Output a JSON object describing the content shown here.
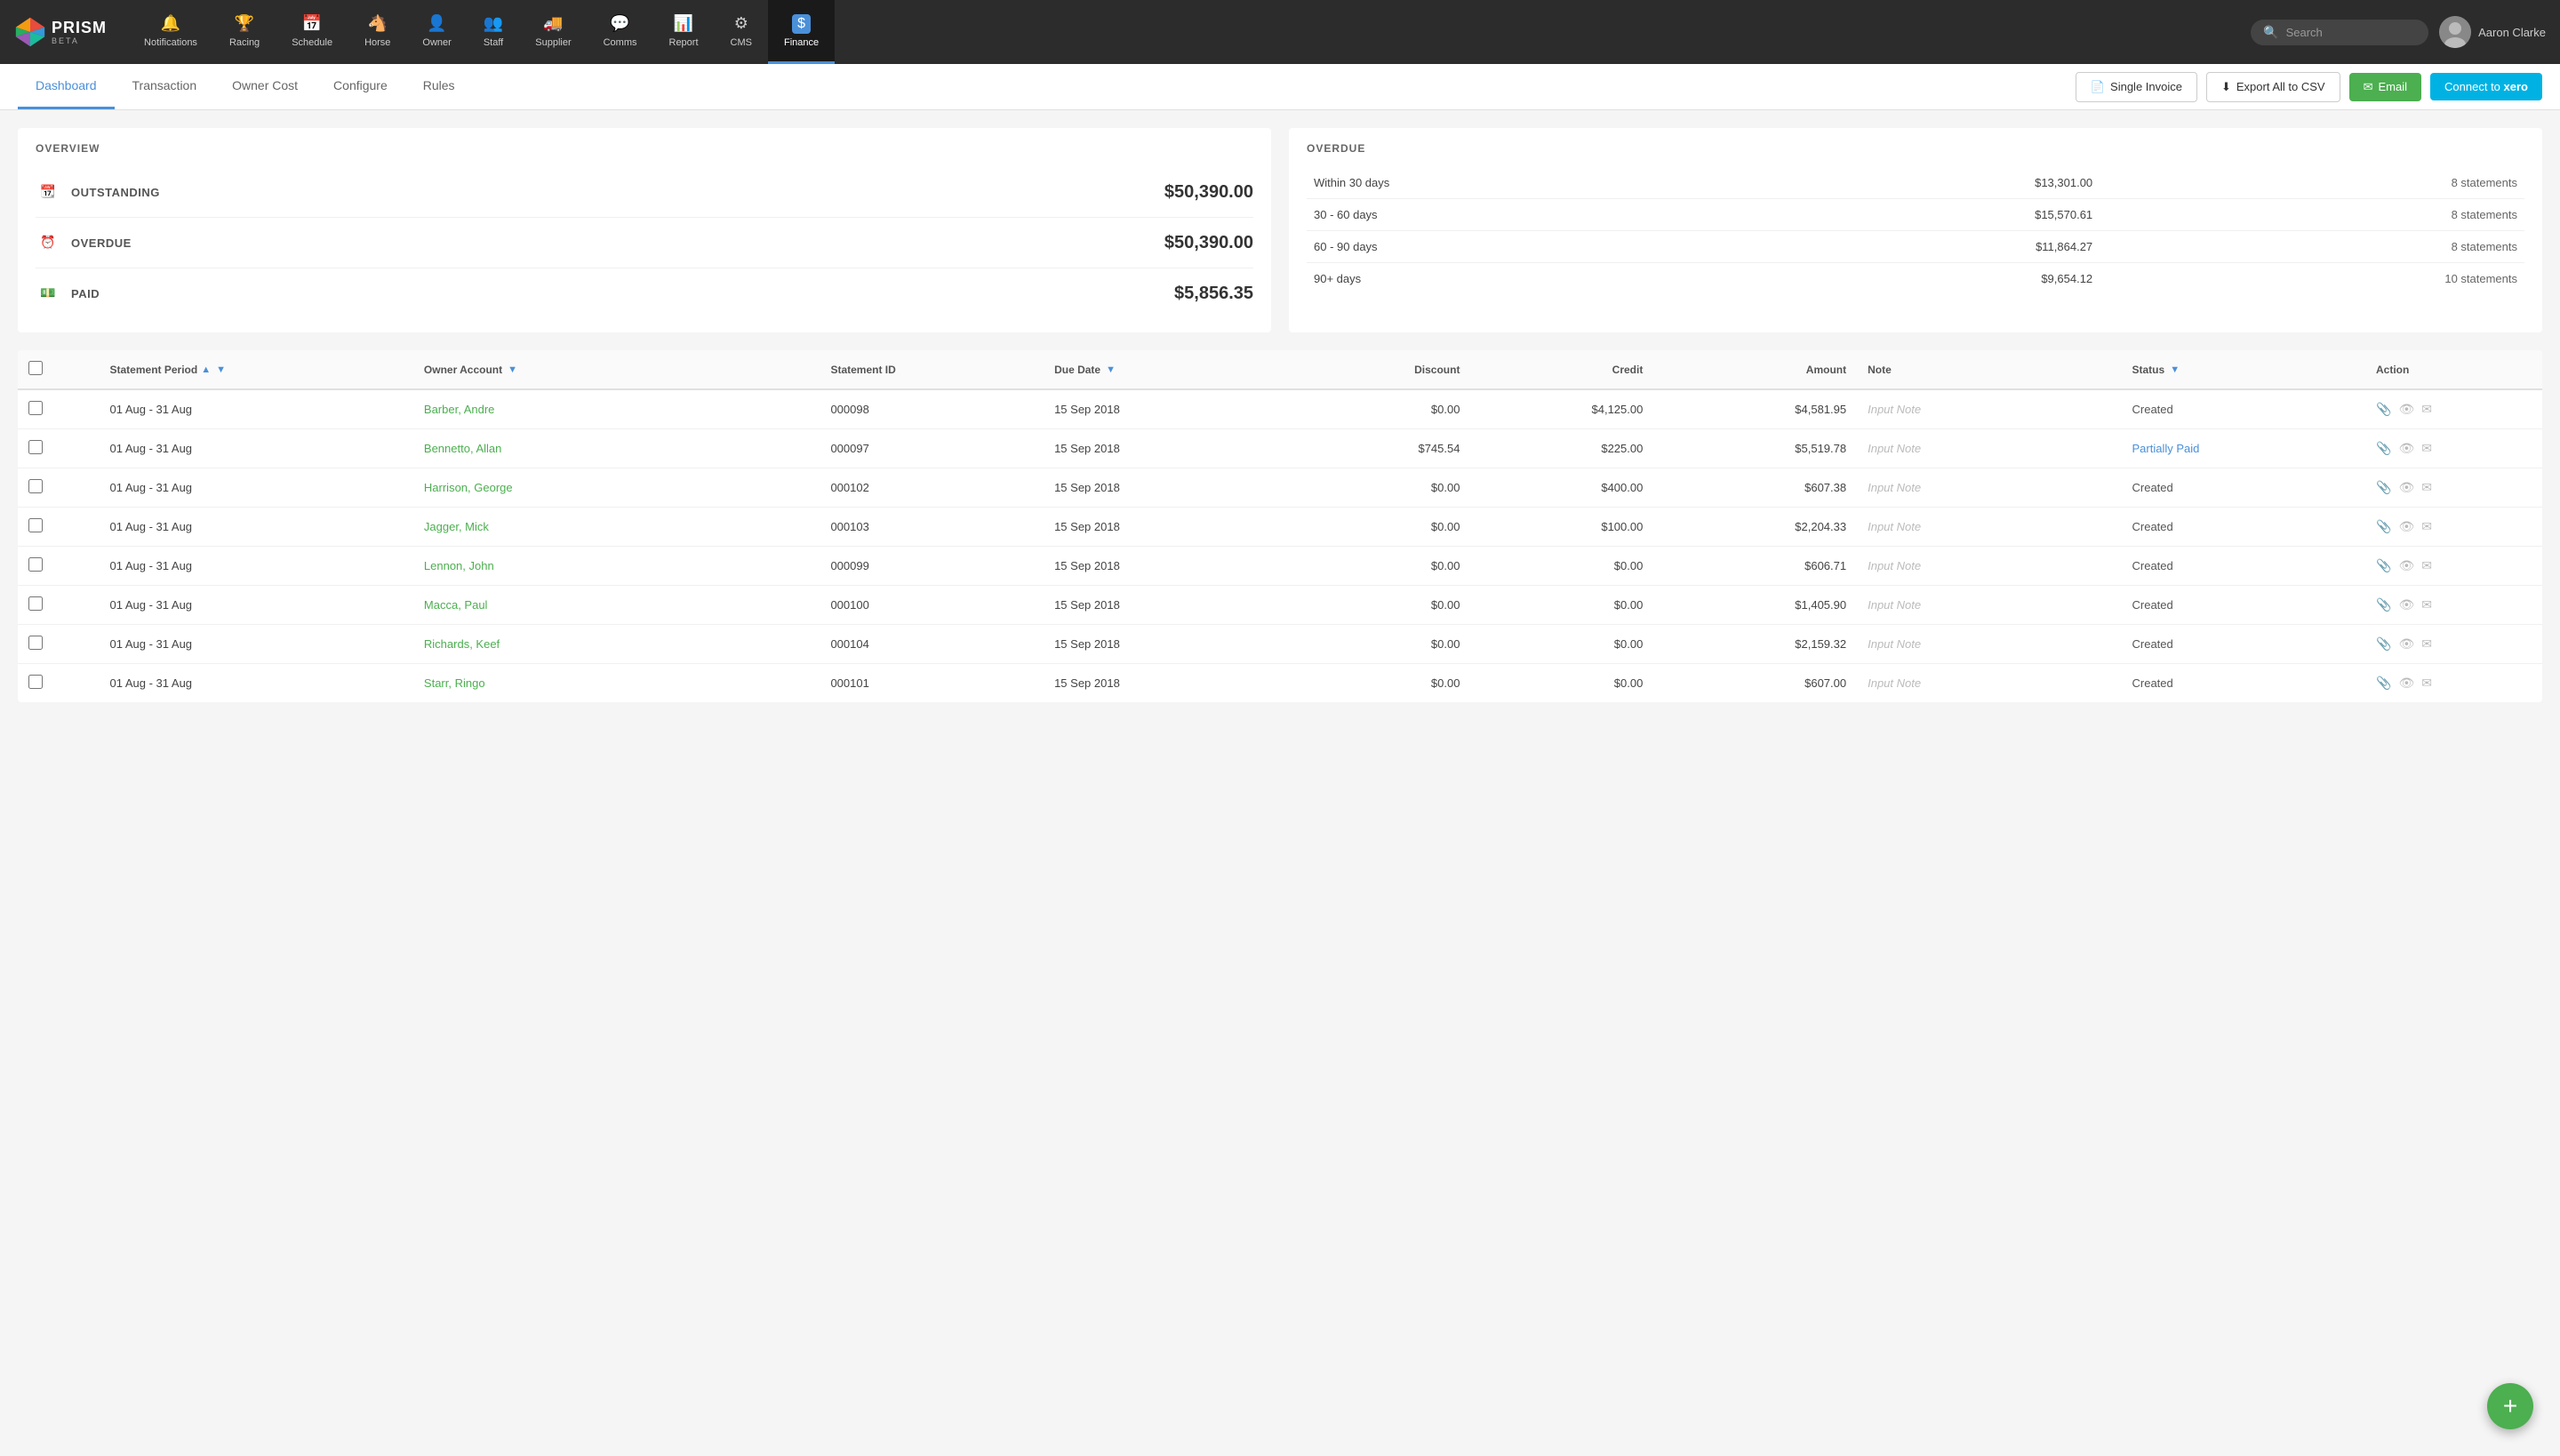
{
  "app": {
    "logo_name": "PRISM",
    "logo_beta": "BETA"
  },
  "nav": {
    "items": [
      {
        "id": "notifications",
        "label": "Notifications",
        "icon": "bell"
      },
      {
        "id": "racing",
        "label": "Racing",
        "icon": "trophy"
      },
      {
        "id": "schedule",
        "label": "Schedule",
        "icon": "calendar"
      },
      {
        "id": "horse",
        "label": "Horse",
        "icon": "horse"
      },
      {
        "id": "owner",
        "label": "Owner",
        "icon": "person"
      },
      {
        "id": "staff",
        "label": "Staff",
        "icon": "staff"
      },
      {
        "id": "supplier",
        "label": "Supplier",
        "icon": "truck"
      },
      {
        "id": "comms",
        "label": "Comms",
        "icon": "chat"
      },
      {
        "id": "report",
        "label": "Report",
        "icon": "report"
      },
      {
        "id": "cms",
        "label": "CMS",
        "icon": "cms"
      },
      {
        "id": "finance",
        "label": "Finance",
        "icon": "finance",
        "active": true
      }
    ],
    "search_placeholder": "Search",
    "user_name": "Aaron Clarke"
  },
  "sub_nav": {
    "tabs": [
      {
        "id": "dashboard",
        "label": "Dashboard",
        "active": true
      },
      {
        "id": "transaction",
        "label": "Transaction",
        "active": false
      },
      {
        "id": "owner_cost",
        "label": "Owner Cost",
        "active": false
      },
      {
        "id": "configure",
        "label": "Configure",
        "active": false
      },
      {
        "id": "rules",
        "label": "Rules",
        "active": false
      }
    ],
    "actions": {
      "single_invoice": "Single Invoice",
      "export_csv": "Export All to CSV",
      "email": "Email",
      "connect_xero": "Connect to"
    }
  },
  "overview": {
    "section_title": "OVERVIEW",
    "items": [
      {
        "id": "outstanding",
        "label": "OUTSTANDING",
        "amount": "$50,390.00",
        "icon": "calendar-sm"
      },
      {
        "id": "overdue",
        "label": "OVERDUE",
        "amount": "$50,390.00",
        "icon": "clock"
      },
      {
        "id": "paid",
        "label": "PAID",
        "amount": "$5,856.35",
        "icon": "dollar"
      }
    ]
  },
  "overdue": {
    "section_title": "OVERDUE",
    "rows": [
      {
        "period": "Within 30 days",
        "amount": "$13,301.00",
        "statements": "8 statements"
      },
      {
        "period": "30 - 60 days",
        "amount": "$15,570.61",
        "statements": "8 statements"
      },
      {
        "period": "60 - 90 days",
        "amount": "$11,864.27",
        "statements": "8 statements"
      },
      {
        "period": "90+ days",
        "amount": "$9,654.12",
        "statements": "10 statements"
      }
    ]
  },
  "table": {
    "columns": [
      {
        "id": "checkbox",
        "label": ""
      },
      {
        "id": "period",
        "label": "Statement Period",
        "sortable": true,
        "filterable": true
      },
      {
        "id": "owner",
        "label": "Owner Account",
        "filterable": true
      },
      {
        "id": "stmt_id",
        "label": "Statement ID"
      },
      {
        "id": "due_date",
        "label": "Due Date",
        "filterable": true
      },
      {
        "id": "discount",
        "label": "Discount"
      },
      {
        "id": "credit",
        "label": "Credit"
      },
      {
        "id": "amount",
        "label": "Amount"
      },
      {
        "id": "note",
        "label": "Note"
      },
      {
        "id": "status",
        "label": "Status",
        "filterable": true
      },
      {
        "id": "action",
        "label": "Action"
      }
    ],
    "rows": [
      {
        "period": "01 Aug - 31 Aug",
        "owner": "Barber, Andre",
        "stmt_id": "000098",
        "due_date": "15 Sep 2018",
        "discount": "$0.00",
        "credit": "$4,125.00",
        "amount": "$4,581.95",
        "note": "Input Note",
        "status": "Created",
        "status_type": "created"
      },
      {
        "period": "01 Aug - 31 Aug",
        "owner": "Bennetto, Allan",
        "stmt_id": "000097",
        "due_date": "15 Sep 2018",
        "discount": "$745.54",
        "credit": "$225.00",
        "amount": "$5,519.78",
        "note": "Input Note",
        "status": "Partially Paid",
        "status_type": "partial"
      },
      {
        "period": "01 Aug - 31 Aug",
        "owner": "Harrison, George",
        "stmt_id": "000102",
        "due_date": "15 Sep 2018",
        "discount": "$0.00",
        "credit": "$400.00",
        "amount": "$607.38",
        "note": "Input Note",
        "status": "Created",
        "status_type": "created"
      },
      {
        "period": "01 Aug - 31 Aug",
        "owner": "Jagger, Mick",
        "stmt_id": "000103",
        "due_date": "15 Sep 2018",
        "discount": "$0.00",
        "credit": "$100.00",
        "amount": "$2,204.33",
        "note": "Input Note",
        "status": "Created",
        "status_type": "created"
      },
      {
        "period": "01 Aug - 31 Aug",
        "owner": "Lennon, John",
        "stmt_id": "000099",
        "due_date": "15 Sep 2018",
        "discount": "$0.00",
        "credit": "$0.00",
        "amount": "$606.71",
        "note": "Input Note",
        "status": "Created",
        "status_type": "created"
      },
      {
        "period": "01 Aug - 31 Aug",
        "owner": "Macca, Paul",
        "stmt_id": "000100",
        "due_date": "15 Sep 2018",
        "discount": "$0.00",
        "credit": "$0.00",
        "amount": "$1,405.90",
        "note": "Input Note",
        "status": "Created",
        "status_type": "created"
      },
      {
        "period": "01 Aug - 31 Aug",
        "owner": "Richards, Keef",
        "stmt_id": "000104",
        "due_date": "15 Sep 2018",
        "discount": "$0.00",
        "credit": "$0.00",
        "amount": "$2,159.32",
        "note": "Input Note",
        "status": "Created",
        "status_type": "created"
      },
      {
        "period": "01 Aug - 31 Aug",
        "owner": "Starr, Ringo",
        "stmt_id": "000101",
        "due_date": "15 Sep 2018",
        "discount": "$0.00",
        "credit": "$0.00",
        "amount": "$607.00",
        "note": "Input Note",
        "status": "Created",
        "status_type": "created"
      }
    ]
  },
  "fab": {
    "label": "+"
  }
}
